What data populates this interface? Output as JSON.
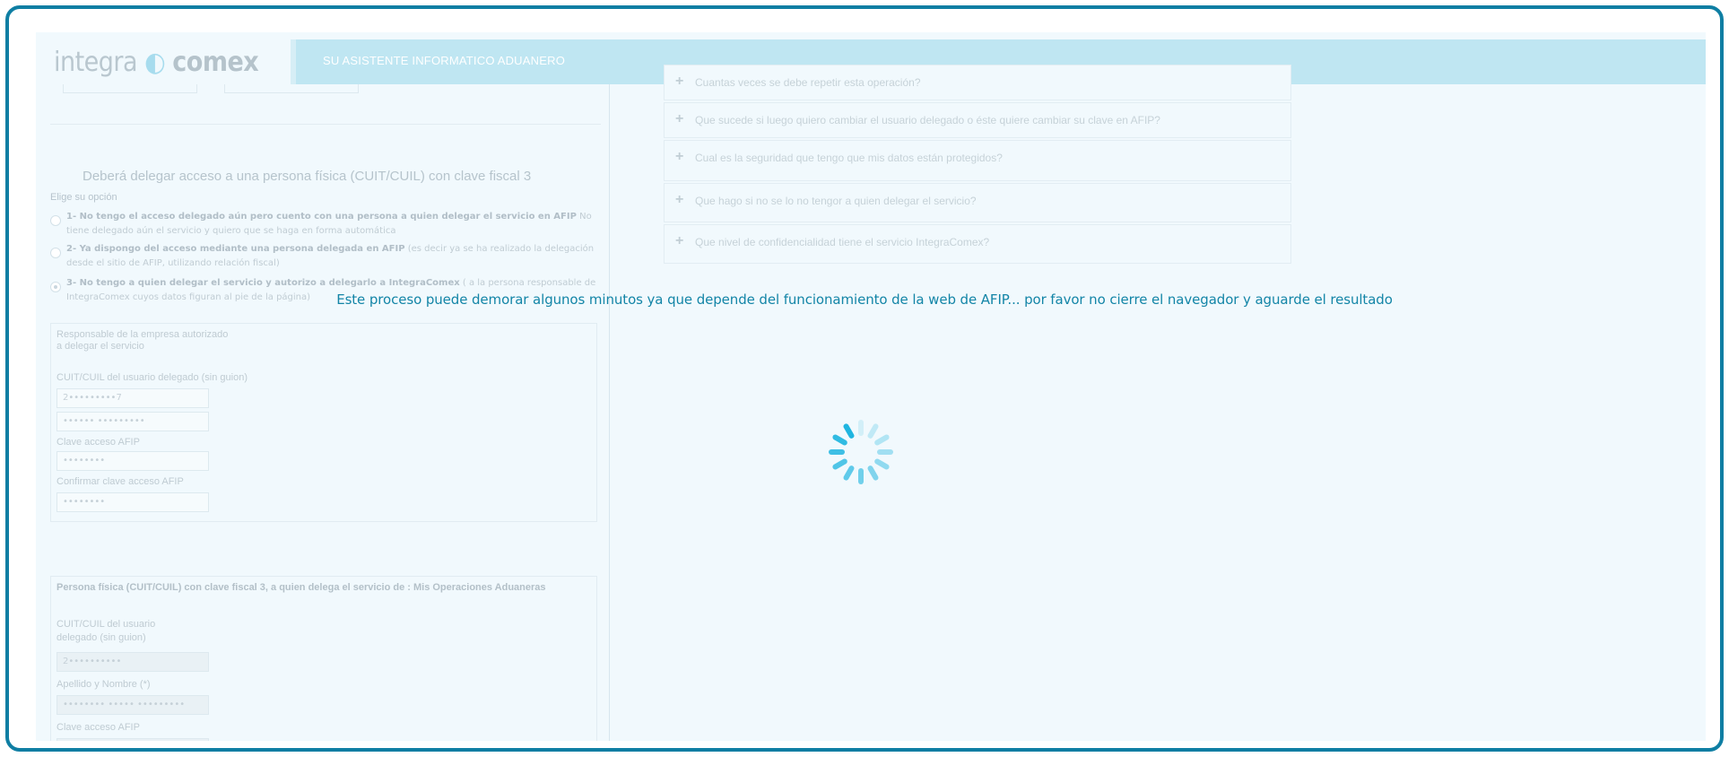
{
  "header": {
    "logo_part1": "integra",
    "logo_part2": "comex",
    "tagline": "SU ASISTENTE INFORMATICO ADUANERO"
  },
  "left": {
    "section_title": "Deberá delegar acceso a una persona física (CUIT/CUIL) con clave fiscal 3",
    "choose_label": "Elige su opción",
    "options": [
      {
        "bold": "1- No tengo el acceso delegado aún pero cuento con una persona a quien delegar el servicio en AFIP",
        "rest": " No tiene delegado aún el servicio y quiero que se haga en forma automática"
      },
      {
        "bold": "2- Ya dispongo del acceso mediante una persona delegada en AFIP",
        "rest": " (es decir ya se ha realizado la delegación desde el sitio de AFIP, utilizando relación fiscal)"
      },
      {
        "bold": "3- No tengo a quien delegar el servicio y autorizo a delegarlo a IntegraComex",
        "rest": " ( a la persona responsable de IntegraComex cuyos datos figuran al pie de la página)"
      }
    ],
    "responsable_box": {
      "title": "Responsable de la empresa autorizado a delegar el servicio",
      "cuit_label": "CUIT/CUIL del usuario delegado (sin guion)",
      "cuit_value": "2•••••••••7",
      "name_value": "•••••• •••••••••",
      "clave_label": "Clave acceso AFIP",
      "clave_value": "••••••••",
      "confirm_label": "Confirmar clave acceso AFIP",
      "confirm_value": "••••••••"
    },
    "persona_box": {
      "title": "Persona física (CUIT/CUIL) con clave fiscal 3, a quien delega el servicio de : Mis Operaciones Aduaneras",
      "cuit_label": "CUIT/CUIL del usuario delegado (sin guion)",
      "cuit_value": "2••••••••••",
      "name_label": "Apellido y Nombre (*)",
      "name_value": "•••••••• ••••• •••••••••",
      "clave_label": "Clave acceso AFIP"
    }
  },
  "faq": [
    "Cuantas veces se debe repetir esta operación?",
    "Que sucede si luego quiero cambiar el usuario delegado o éste quiere cambiar su clave en AFIP?",
    "Cual es la seguridad que tengo que mis datos están protegidos?",
    "Que hago si no se lo no tengor a quien delegar el servicio?",
    "Que nivel de confidencialidad tiene el servicio IntegraComex?"
  ],
  "overlay": {
    "message": "Este proceso puede demorar algunos minutos ya que depende del funcionamiento de la web de AFIP... por favor no cierre el navegador y aguarde el resultado"
  },
  "colors": {
    "frame_border": "#0e7ea3",
    "overlay_text": "#1385a7",
    "spinner": "#1fb5e0"
  }
}
